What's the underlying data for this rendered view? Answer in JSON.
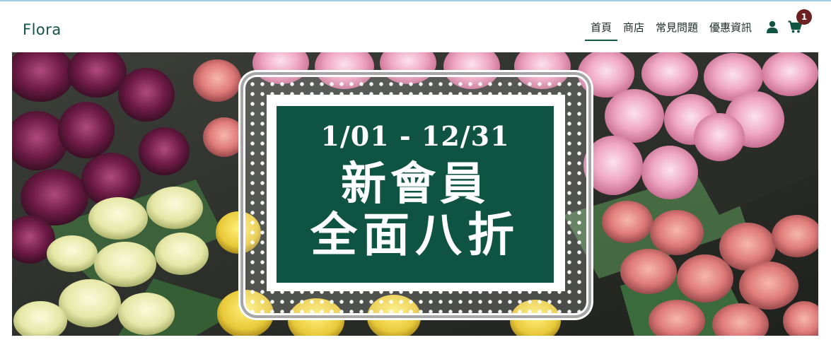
{
  "navbar": {
    "brand": "Flora",
    "links": [
      {
        "label": "首頁",
        "active": true
      },
      {
        "label": "商店",
        "active": false
      },
      {
        "label": "常見問題",
        "active": false
      },
      {
        "label": "優惠資訊",
        "active": false
      }
    ],
    "user_icon": "user-icon",
    "cart_icon": "cart-icon",
    "cart_count": "1"
  },
  "hero": {
    "date_range": "1/01 - 12/31",
    "headline_line1": "新會員",
    "headline_line2": "全面八折"
  },
  "colors": {
    "brand_green": "#11543f",
    "panel_green": "#0f5442",
    "badge": "#6b2220"
  }
}
